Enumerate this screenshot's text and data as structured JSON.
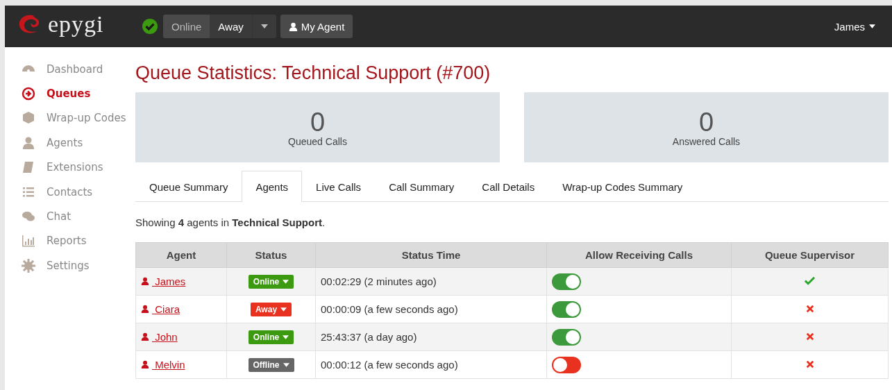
{
  "header": {
    "logo": "epygi",
    "presence": [
      {
        "label": "Online",
        "selected": false
      },
      {
        "label": "Away",
        "selected": true
      }
    ],
    "agent_button": "My Agent",
    "user": "James"
  },
  "sidebar": {
    "items": [
      {
        "label": "Dashboard",
        "selected": false
      },
      {
        "label": "Queues",
        "selected": true
      },
      {
        "label": "Wrap-up Codes",
        "selected": false
      },
      {
        "label": "Agents",
        "selected": false
      },
      {
        "label": "Extensions",
        "selected": false
      },
      {
        "label": "Contacts",
        "selected": false
      },
      {
        "label": "Chat",
        "selected": false
      },
      {
        "label": "Reports",
        "selected": false
      },
      {
        "label": "Settings",
        "selected": false
      }
    ]
  },
  "title": "Queue Statistics: Technical Support (#700)",
  "stats": [
    {
      "value": "0",
      "label": "Queued Calls"
    },
    {
      "value": "0",
      "label": "Answered Calls"
    }
  ],
  "tabs": [
    {
      "label": "Queue Summary",
      "selected": false
    },
    {
      "label": "Agents",
      "selected": true
    },
    {
      "label": "Live Calls",
      "selected": false
    },
    {
      "label": "Call Summary",
      "selected": false
    },
    {
      "label": "Call Details",
      "selected": false
    },
    {
      "label": "Wrap-up Codes Summary",
      "selected": false
    }
  ],
  "summary": "Showing **4** agents in **Technical Support**.",
  "table": {
    "columns": [
      "Agent",
      "Status",
      "Status Time",
      "Allow Receiving Calls",
      "Queue Supervisor"
    ],
    "rows": [
      {
        "agent": "James",
        "status": "Online",
        "color": "#3c9a10",
        "time": "00:02:29 (2 minutes ago)",
        "receiving": true,
        "supervisor": true
      },
      {
        "agent": "Ciara",
        "status": "Away",
        "color": "#e8321f",
        "time": "00:00:09 (a few seconds ago)",
        "receiving": true,
        "supervisor": false
      },
      {
        "agent": "John",
        "status": "Online",
        "color": "#3c9a10",
        "time": "25:43:37 (a day ago)",
        "receiving": true,
        "supervisor": false
      },
      {
        "agent": "Melvin",
        "status": "Offline",
        "color": "#666666",
        "time": "00:00:12 (a few seconds ago)",
        "receiving": false,
        "supervisor": false
      }
    ]
  }
}
